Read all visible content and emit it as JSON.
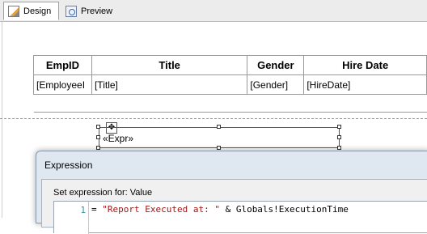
{
  "tabs": [
    {
      "label": "Design",
      "icon": "design-pencil-icon",
      "active": true
    },
    {
      "label": "Preview",
      "icon": "preview-icon",
      "active": false
    }
  ],
  "table": {
    "headers": [
      "EmpID",
      "Title",
      "Gender",
      "Hire Date"
    ],
    "row": [
      "[EmployeeI",
      "[Title]",
      "[Gender]",
      "[HireDate]"
    ]
  },
  "textbox": {
    "value": "«Expr»"
  },
  "dialog": {
    "title": "Expression",
    "set_label": "Set expression for: Value",
    "line_number": "1",
    "code_eq": "= ",
    "code_string": "\"Report Executed at: \"",
    "code_rest": " & Globals!ExecutionTime"
  },
  "colors": {
    "string": "#a31515",
    "line_number": "#2b91af",
    "dialog_bg": "#dfe7f1"
  }
}
